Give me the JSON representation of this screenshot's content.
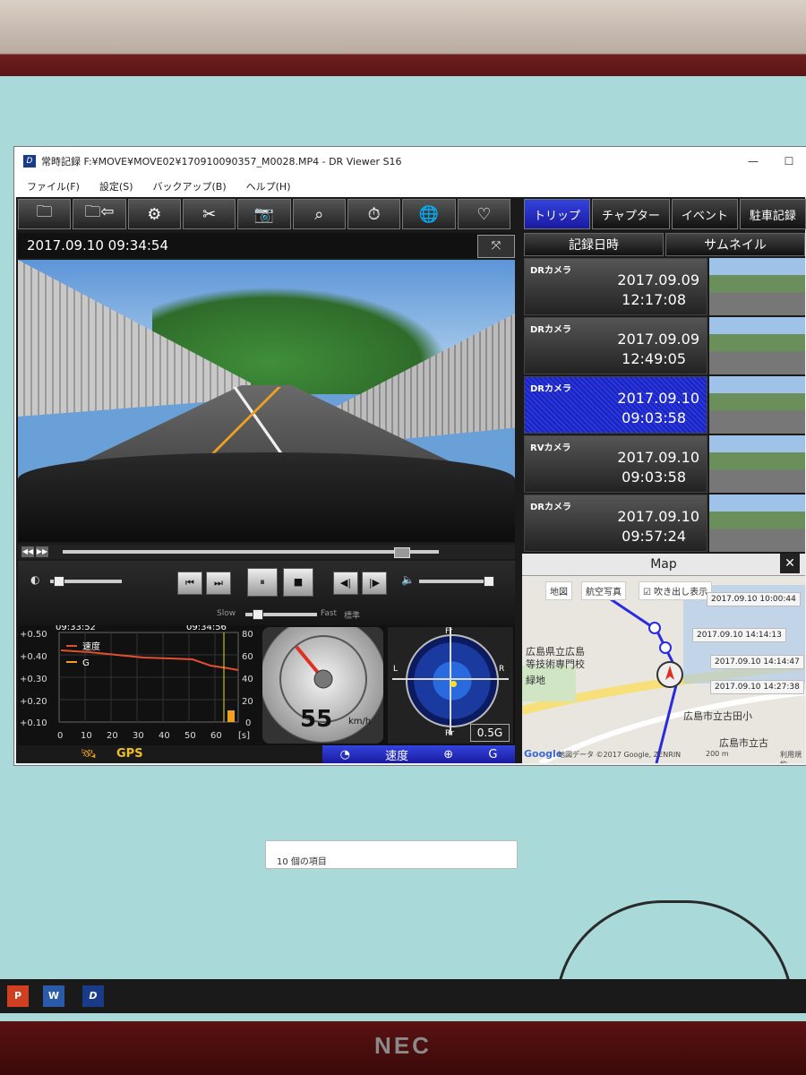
{
  "monitor": {
    "brand": "NEC"
  },
  "window": {
    "title": "常時記録 F:¥MOVE¥MOVE02¥170910090357_M0028.MP4 - DR Viewer S16",
    "app_icon": "D",
    "minimize": "—",
    "maximize": "☐"
  },
  "menu": [
    "ファイル(F)",
    "設定(S)",
    "バックアップ(B)",
    "ヘルプ(H)"
  ],
  "tabs": [
    "トリップ",
    "チャプター",
    "イベント",
    "駐車記録"
  ],
  "video": {
    "datetime": "2017.09.10 09:34:54"
  },
  "controls": {
    "slow": "Slow",
    "fast": "Fast",
    "standard": "標準"
  },
  "graph": {
    "time_start": "09:33:52",
    "time_end": "09:34:56",
    "left_ticks": [
      "+0.50",
      "+0.40",
      "+0.30",
      "+0.20",
      "+0.10"
    ],
    "right_ticks": [
      "80",
      "60",
      "40",
      "20",
      "0"
    ],
    "x_ticks": [
      "0",
      "10",
      "20",
      "30",
      "40",
      "50",
      "60"
    ],
    "x_unit": "[s]",
    "legend_speed": "速度",
    "legend_g": "G"
  },
  "speedometer": {
    "speed": "55",
    "unit": "km/h"
  },
  "gforce": {
    "value": "0.5G",
    "left": "L",
    "right": "R",
    "front": "Fr",
    "rear": "Rr"
  },
  "bottom_bar": {
    "gps": "GPS",
    "speed_btn": "速度",
    "g_btn": "G"
  },
  "list": {
    "head_date": "記録日時",
    "head_thumb": "サムネイル",
    "rows": [
      {
        "cam": "DRカメラ",
        "date": "2017.09.09",
        "time": "12:17:08"
      },
      {
        "cam": "DRカメラ",
        "date": "2017.09.09",
        "time": "12:49:05"
      },
      {
        "cam": "DRカメラ",
        "date": "2017.09.10",
        "time": "09:03:58"
      },
      {
        "cam": "RVカメラ",
        "date": "2017.09.10",
        "time": "09:03:58"
      },
      {
        "cam": "DRカメラ",
        "date": "2017.09.10",
        "time": "09:57:24"
      }
    ]
  },
  "map": {
    "title": "Map",
    "tab_map": "地図",
    "tab_sat": "航空写真",
    "popup_toggle": "吹き出し表示",
    "popups": [
      "2017.09.10 10:00:44",
      "2017.09.10 14:14:13",
      "2017.09.10 14:14:47",
      "2017.09.10 14:27:38"
    ],
    "label_school1": "広島県立広島",
    "label_school2": "等技術専門校",
    "label_green": "緑地",
    "label_elem": "広島市立古田小",
    "label_elem2": "広島市立古",
    "footer": "地図データ ©2017 Google, ZENRIN",
    "scale": "200 m",
    "terms": "利用規約",
    "google": "Google"
  },
  "explorer": {
    "items": "10 個の項目"
  }
}
